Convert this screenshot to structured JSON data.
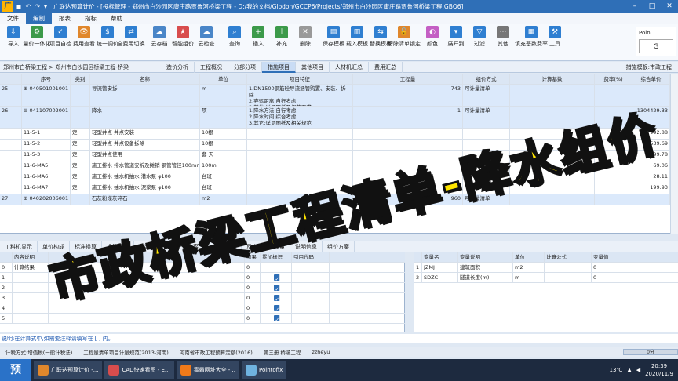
{
  "titlebar": {
    "app_icon": "广",
    "title": "广联达预算计价 - [投标管理 - 郑州市白沙园区康庄路贾鲁河桥梁工程 - D:/我的文档/Glodon/GCCP6/Projects/郑州市白沙园区康庄路贾鲁河桥梁工程.GBQ6]"
  },
  "menu": [
    "文件",
    "编制",
    "报表",
    "指标",
    "帮助"
  ],
  "menu_active": "编制",
  "ribbon": [
    {
      "label": "导入",
      "icon": "import-icon"
    },
    {
      "label": "量价一体化",
      "icon": "integrate-icon"
    },
    {
      "label": "项目自检",
      "icon": "check-icon"
    },
    {
      "label": "费用查看",
      "icon": "view-icon"
    },
    {
      "label": "统一调价",
      "icon": "adjust-icon"
    },
    {
      "label": "全费用切换",
      "icon": "switch-icon"
    },
    {
      "label": "云存档",
      "icon": "cloud-icon"
    },
    {
      "label": "智能组价",
      "icon": "smart-icon"
    },
    {
      "label": "云检查",
      "icon": "cloudcheck-icon"
    },
    {
      "label": "查询",
      "icon": "search-icon"
    },
    {
      "label": "插入",
      "icon": "insert-icon"
    },
    {
      "label": "补充",
      "icon": "add-icon"
    },
    {
      "label": "删除",
      "icon": "delete-icon"
    },
    {
      "label": "保存模板",
      "icon": "save-icon"
    },
    {
      "label": "载入模板",
      "icon": "load-icon"
    },
    {
      "label": "替换模板",
      "icon": "replace-icon"
    },
    {
      "label": "解除清单锁定",
      "icon": "unlock-icon"
    },
    {
      "label": "颜色",
      "icon": "color-icon"
    },
    {
      "label": "展开到",
      "icon": "expand-icon"
    },
    {
      "label": "过滤",
      "icon": "filter-icon"
    },
    {
      "label": "其他",
      "icon": "other-icon"
    },
    {
      "label": "填充基数费率",
      "icon": "fill-icon"
    },
    {
      "label": "工具",
      "icon": "tool-icon"
    }
  ],
  "popup": {
    "title": "Poin...",
    "code": "G"
  },
  "breadcrumb": {
    "path": "郑州市白桥梁工程 > 郑州市白沙园区桥梁工程-桥梁"
  },
  "tabs": [
    "造价分析",
    "工程概况",
    "分部分项",
    "措施项目",
    "其他项目",
    "人材机汇总",
    "费用汇总"
  ],
  "tab_active": "措施项目",
  "template": "措施模板:市政工程",
  "grid": {
    "headers": [
      "序号",
      "类别",
      "名称",
      "单位",
      "项目特征",
      "工程量",
      "组价方式",
      "计算基数",
      "费率(%)",
      "综合单价"
    ],
    "rows": [
      {
        "idx": "25",
        "code": "040501001001",
        "type": "",
        "name": "导流管安拆",
        "unit": "m",
        "feature": "1.DN1500钢筋砼导流涵管购置、安装、拆除\n2.弃运距离:自行考虑\n3.其他:详见图纸及规范要求",
        "qty": "743",
        "method": "可计量清单",
        "base": "",
        "rate": "",
        "price": "",
        "hl": true,
        "tall": true
      },
      {
        "idx": "26",
        "code": "041107002001",
        "type": "",
        "name": "降水",
        "unit": "项",
        "feature": "1.降水方法:自行考虑\n2.降水时间:综合考虑\n3.其它:详见图纸及相关规范",
        "qty": "1",
        "method": "可计量清单",
        "base": "",
        "rate": "",
        "price": "1304429.33",
        "hl": true,
        "tall": true
      },
      {
        "idx": "",
        "code": "11-5-1",
        "type": "定",
        "name": "轻型井点 井点安装",
        "unit": "10根",
        "feature": "",
        "qty": "",
        "method": "",
        "base": "",
        "rate": "",
        "price": "992.88"
      },
      {
        "idx": "",
        "code": "11-5-2",
        "type": "定",
        "name": "轻型井点 井点设备拆除",
        "unit": "10根",
        "feature": "",
        "qty": "",
        "method": "",
        "base": "",
        "rate": "",
        "price": "539.69"
      },
      {
        "idx": "",
        "code": "11-5-3",
        "type": "定",
        "name": "轻型井点使用",
        "unit": "套·天",
        "feature": "",
        "qty": "",
        "method": "",
        "base": "",
        "rate": "",
        "price": "799.78"
      },
      {
        "idx": "",
        "code": "11-6-MA5",
        "type": "定",
        "name": "施工排水 排水管道安拆及摊销 钢管管径100mm",
        "unit": "100m",
        "feature": "",
        "qty": "",
        "method": "",
        "base": "",
        "rate": "",
        "price": "69.06"
      },
      {
        "idx": "",
        "code": "11-6-MA6",
        "type": "定",
        "name": "施工排水 抽水机抽水 潜水泵 φ100",
        "unit": "台班",
        "feature": "",
        "qty": "",
        "method": "",
        "base": "",
        "rate": "",
        "price": "28.11"
      },
      {
        "idx": "",
        "code": "11-6-MA7",
        "type": "定",
        "name": "施工排水 抽水机抽水 泥浆泵 φ100",
        "unit": "台班",
        "feature": "",
        "qty": "",
        "method": "",
        "base": "",
        "rate": "",
        "price": "199.93"
      },
      {
        "idx": "27",
        "code": "040202006001",
        "type": "",
        "name": "石灰粉煤灰碎石",
        "unit": "m2",
        "feature": "",
        "qty": "960",
        "method": "可计量清单",
        "base": "",
        "rate": "",
        "price": "",
        "hl": true
      }
    ]
  },
  "bottom_tabs": [
    "工料机显示",
    "单价构成",
    "标准换算",
    "换算信息",
    "安装费用",
    "特征及内容",
    "工程量明细",
    "反查图形工程量",
    "说明信息",
    "组价方案"
  ],
  "left_panel": {
    "headers": [
      "内容说明",
      "",
      "结果",
      "累加标识",
      "引用代码"
    ],
    "rows": [
      {
        "n": "0",
        "label": "计算结果",
        "result": "0"
      },
      {
        "n": "1",
        "label": "",
        "result": "0"
      },
      {
        "n": "2",
        "label": "",
        "result": "0"
      },
      {
        "n": "3",
        "label": "",
        "result": "0"
      },
      {
        "n": "4",
        "label": "",
        "result": "0"
      },
      {
        "n": "5",
        "label": "",
        "result": "0"
      }
    ]
  },
  "right_panel": {
    "headers": [
      "变量名",
      "变量说明",
      "单位",
      "计算公式",
      "变量值"
    ],
    "rows": [
      {
        "n": "1",
        "name": "JZMJ",
        "desc": "建筑面积",
        "unit": "m2",
        "formula": "",
        "value": "0"
      },
      {
        "n": "2",
        "name": "SDZC",
        "desc": "隧道长度(m)",
        "unit": "m",
        "formula": "",
        "value": "0"
      }
    ]
  },
  "hint": "说明:在计算式中,如需要注释请填写在 [ ] 内。",
  "status": [
    "计税方式:增值税(一般计税法)",
    "工程量清单项目计量规范(2013-河南)",
    "河南省市政工程预算定额(2016)",
    "第三册 桥涵工程",
    "zzheyu"
  ],
  "status_zoom": "0分",
  "taskbar": {
    "start": "预",
    "items": [
      "广联达预算计价 -...",
      "CAD快速看图 - E...",
      "毒霸网址大全 -...",
      "Pointofix"
    ],
    "weather": "13℃",
    "time": "20:39",
    "date": "2020/11/9"
  },
  "overlay_text": "市政桥梁工程清单-降水组价"
}
